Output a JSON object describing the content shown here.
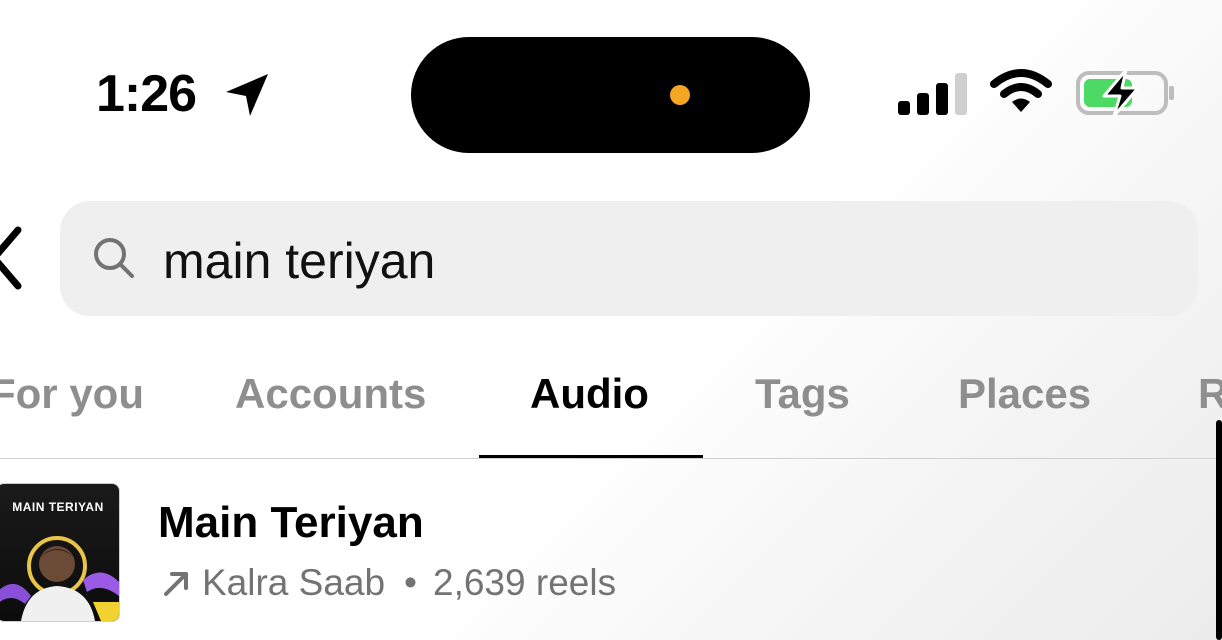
{
  "status_bar": {
    "time": "1:26",
    "location_icon": "location-arrow-icon",
    "signal_icon": "cellular-signal-icon",
    "wifi_icon": "wifi-icon",
    "battery_icon": "battery-charging-icon",
    "island_indicator_color": "#f5a623"
  },
  "search": {
    "back_icon": "chevron-left-icon",
    "search_icon": "search-icon",
    "query": "main teriyan"
  },
  "tabs": {
    "items": [
      {
        "label": "For you"
      },
      {
        "label": "Accounts"
      },
      {
        "label": "Audio"
      },
      {
        "label": "Tags"
      },
      {
        "label": "Places"
      },
      {
        "label": "R"
      }
    ],
    "active": "Audio"
  },
  "results": [
    {
      "thumbnail_title": "MAIN TERIYAN",
      "title": "Main Teriyan",
      "trend_icon": "trending-arrow-icon",
      "artist": "Kalra Saab",
      "separator": "•",
      "reels": "2,639 reels"
    }
  ],
  "colors": {
    "battery_fill": "#4cd964",
    "inactive_tab": "#8e8e8e",
    "search_bg": "#efefef"
  }
}
